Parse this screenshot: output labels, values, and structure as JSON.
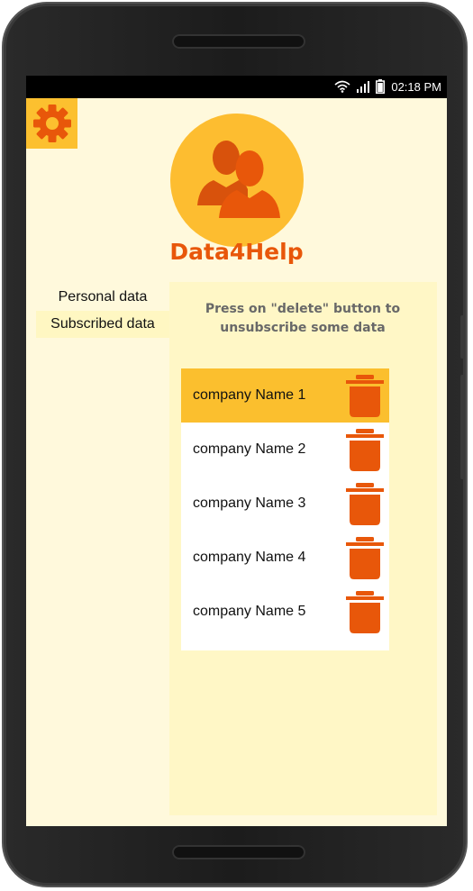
{
  "status_bar": {
    "time": "02:18 PM"
  },
  "app": {
    "title": "Data4Help"
  },
  "menu": {
    "items": [
      {
        "label": "Personal data"
      },
      {
        "label": "Subscribed data"
      }
    ]
  },
  "panel": {
    "hint": "Press on \"delete\" button to unsubscribe some data",
    "companies": [
      {
        "name": "company Name 1"
      },
      {
        "name": "company Name 2"
      },
      {
        "name": "company Name 3"
      },
      {
        "name": "company Name 4"
      },
      {
        "name": "company Name 5"
      }
    ]
  },
  "colors": {
    "accent": "#e8570a",
    "highlight": "#fbbf2e",
    "background": "#fff9dc"
  },
  "icons": [
    "settings-gear-icon",
    "users-icon",
    "trash-icon",
    "wifi-icon",
    "signal-icon",
    "battery-icon"
  ]
}
